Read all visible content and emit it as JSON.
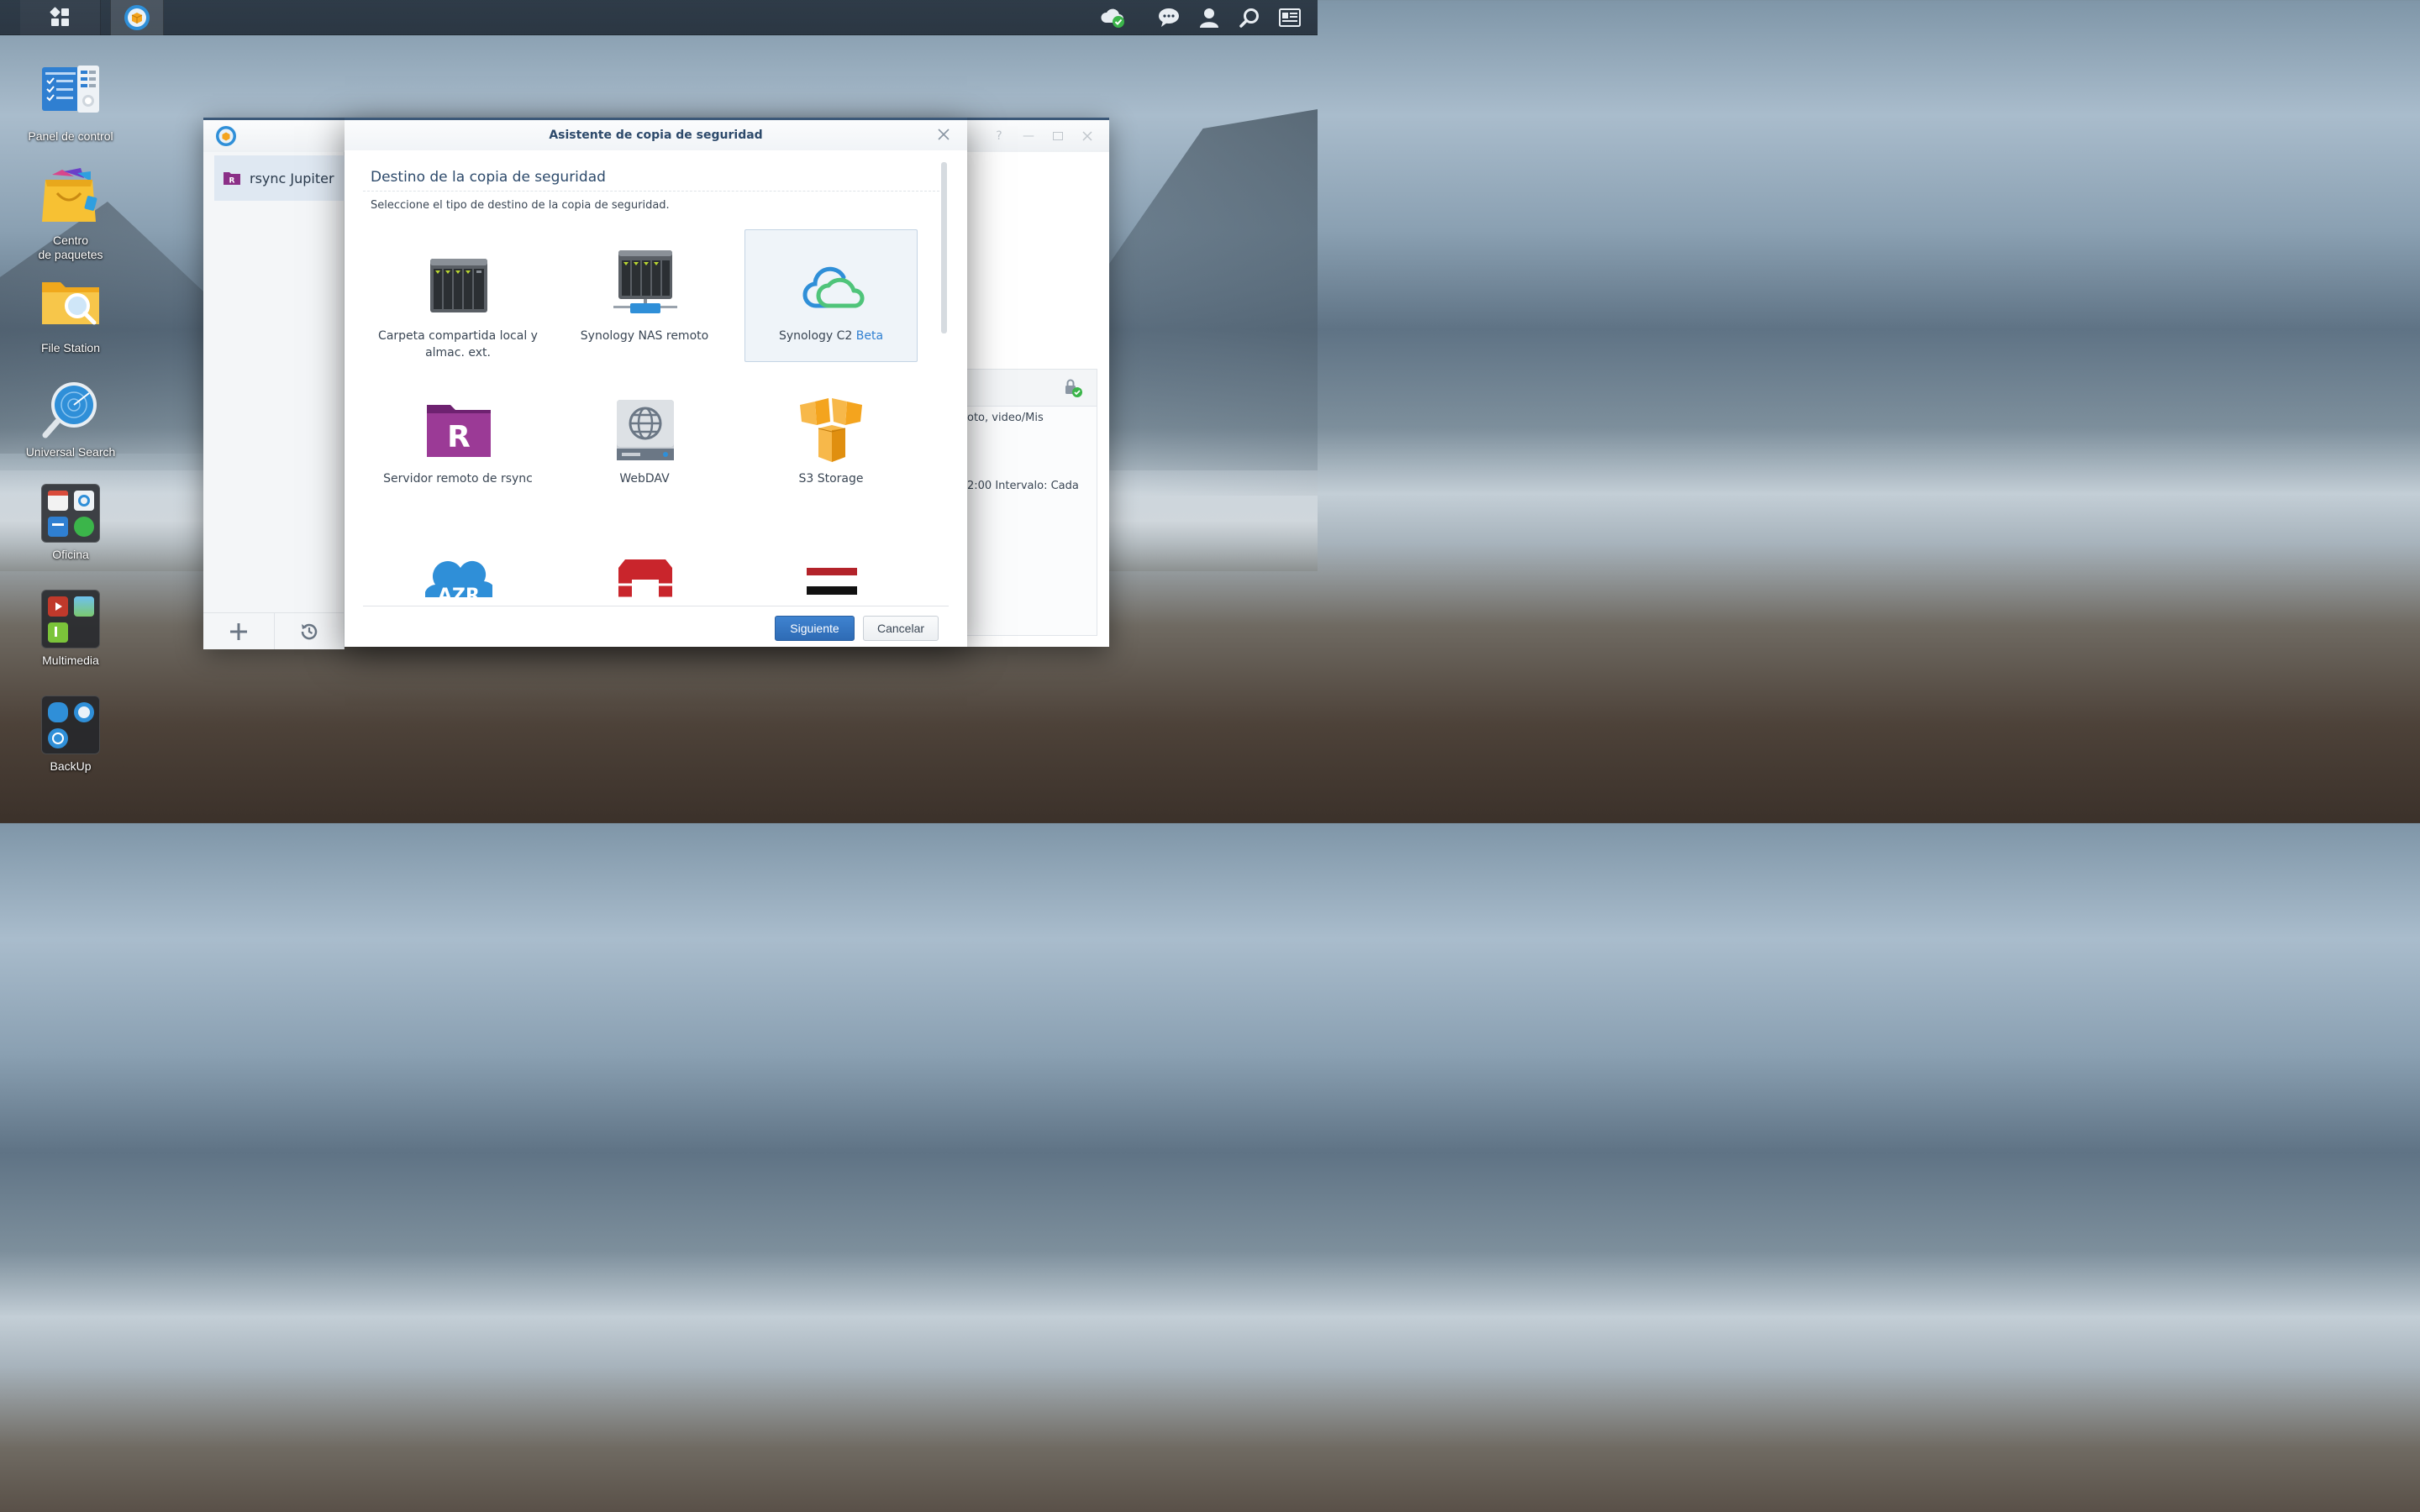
{
  "desktop": {
    "icons": [
      {
        "label": "Panel de control"
      },
      {
        "label": "Centro\nde paquetes"
      },
      {
        "label": "File Station"
      },
      {
        "label": "Universal Search"
      },
      {
        "label": "Oficina"
      },
      {
        "label": "Multimedia"
      },
      {
        "label": "BackUp"
      }
    ]
  },
  "app_window": {
    "sidebar_item": "rsync Jupiter",
    "detail_line1": "oto, video/Mis",
    "detail_line2": "2:00 Intervalo: Cada"
  },
  "dialog": {
    "title": "Asistente de copia de seguridad",
    "heading": "Destino de la copia de seguridad",
    "subtitle": "Seleccione el tipo de destino de la copia de seguridad.",
    "options": [
      {
        "label": "Carpeta compartida local y almac. ext.",
        "icon": "nas-local-icon"
      },
      {
        "label": "Synology NAS remoto",
        "icon": "nas-remote-icon"
      },
      {
        "label": "Synology C2",
        "badge": "Beta",
        "icon": "cloud-c2-icon",
        "selected": true
      },
      {
        "label": "Servidor remoto de rsync",
        "icon": "rsync-folder-icon"
      },
      {
        "label": "WebDAV",
        "icon": "webdav-icon"
      },
      {
        "label": "S3 Storage",
        "icon": "s3-cubes-icon"
      }
    ],
    "next_button": "Siguiente",
    "cancel_button": "Cancelar"
  },
  "colors": {
    "accent": "#2f7fd1",
    "title": "#2d4a6b",
    "c2_blue": "#2f8fd8",
    "c2_green": "#4fc47a",
    "rsync_purple": "#8b2f87",
    "s3_orange": "#f4a41e"
  }
}
